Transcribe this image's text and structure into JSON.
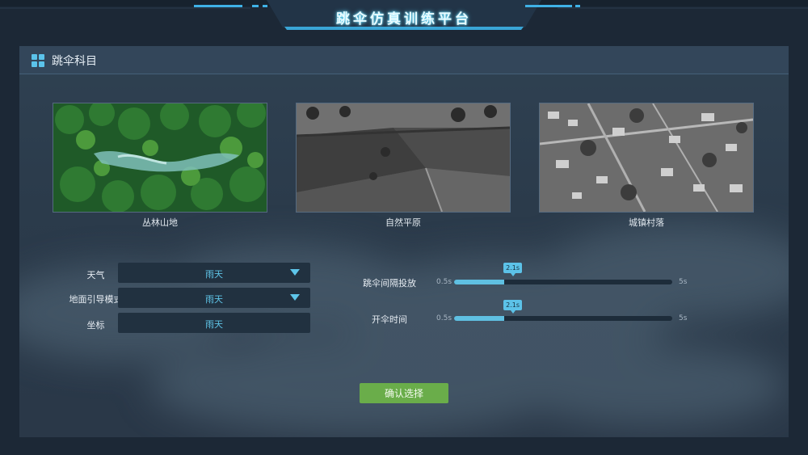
{
  "app": {
    "title": "跳伞仿真训练平台"
  },
  "panel": {
    "title": "跳伞科目"
  },
  "terrains": [
    {
      "label": "丛林山地",
      "icon": "jungle-aerial-image"
    },
    {
      "label": "自然平原",
      "icon": "plains-aerial-image"
    },
    {
      "label": "城镇村落",
      "icon": "town-aerial-image"
    }
  ],
  "form": {
    "weather": {
      "label": "天气",
      "value": "雨天"
    },
    "guide_mode": {
      "label": "地面引导模式",
      "value": "雨天"
    },
    "coordinates": {
      "label": "坐标",
      "value": "雨天"
    }
  },
  "sliders": {
    "interval": {
      "label": "跳伞间隔投放",
      "min": "0.5s",
      "max": "5s",
      "value": "2.1s",
      "fraction": 0.23
    },
    "open_time": {
      "label": "开伞时间",
      "min": "0.5s",
      "max": "5s",
      "value": "2.1s",
      "fraction": 0.23
    }
  },
  "confirm": {
    "label": "确认选择"
  },
  "colors": {
    "accent": "#5fc0e2",
    "confirm": "#6aad4a",
    "background": "#1c2836"
  }
}
